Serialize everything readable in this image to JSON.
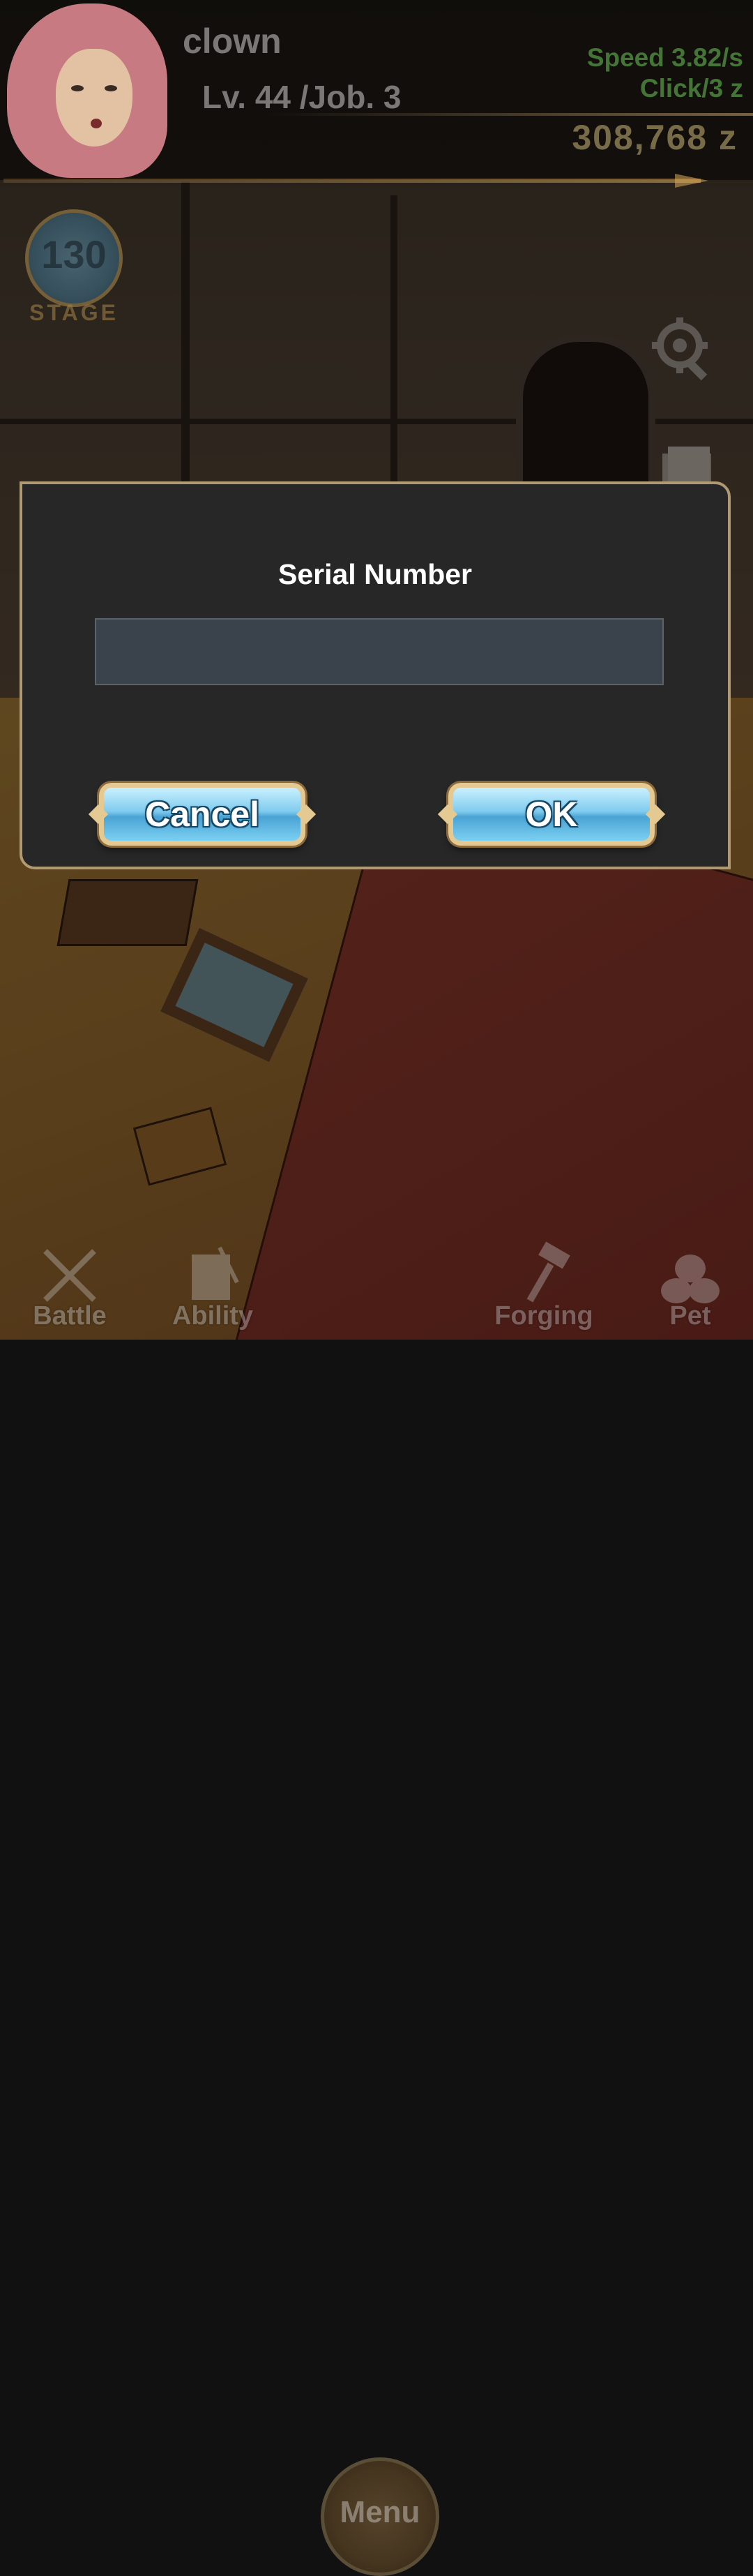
{
  "header": {
    "character_name": "clown",
    "level_job": "Lv. 44 /Job. 3",
    "speed": "Speed 3.82/s",
    "click_reward": "Click/3 z",
    "zeny": "308,768 z"
  },
  "stage": {
    "number": "130",
    "label": "STAGE"
  },
  "dialog": {
    "title": "Serial Number",
    "input_value": "",
    "cancel_label": "Cancel",
    "ok_label": "OK"
  },
  "side_icons": [
    "gear-icon",
    "book-icon"
  ],
  "bottom_nav": {
    "battle": "Battle",
    "ability": "Ability",
    "menu": "Menu",
    "forging": "Forging",
    "pet": "Pet"
  },
  "colors": {
    "dialog_bg": "#272727",
    "dialog_border": "#b09a74",
    "input_bg": "#3a424b",
    "button_blue": "#7fcbee",
    "button_frame": "#e4c993",
    "speed_text": "#5aa14a",
    "zeny_text": "#cdb77a"
  }
}
